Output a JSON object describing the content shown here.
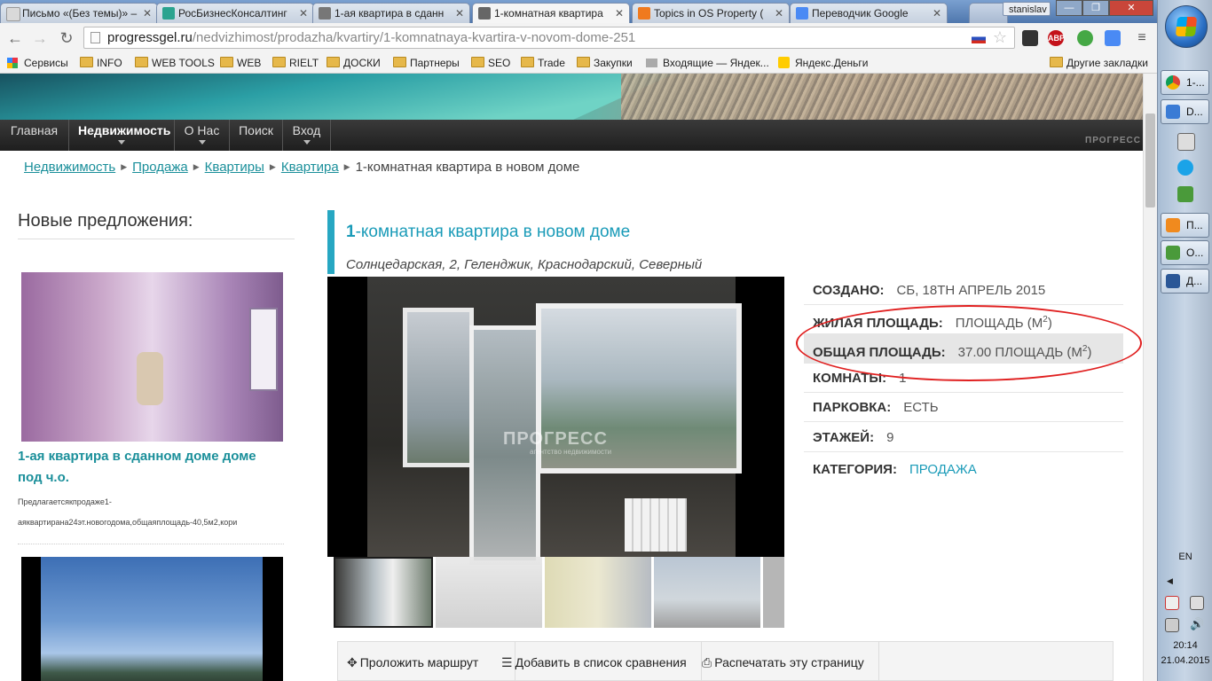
{
  "browser": {
    "tabs": [
      {
        "label": "Письмо «(Без темы)» –"
      },
      {
        "label": "РосБизнесКонсалтинг"
      },
      {
        "label": "1-ая квартира в сданн"
      },
      {
        "label": "1-комнатная квартира"
      },
      {
        "label": "Topics in OS Property ("
      },
      {
        "label": "Переводчик Google"
      }
    ],
    "user_badge": "stanislav",
    "url_host": "progressgel.ru",
    "url_path": "/nedvizhimost/prodazha/kvartiry/1-komnatnaya-kvartira-v-novom-dome-251",
    "abp_label": "ABP",
    "bookmarks": [
      "Сервисы",
      "INFO",
      "WEB TOOLS",
      "WEB",
      "RIELT",
      "ДОСКИ",
      "Партнеры",
      "SEO",
      "Trade",
      "Закупки",
      "Входящие — Яндек...",
      "Яндекс.Деньги"
    ],
    "other_bookmarks": "Другие закладки"
  },
  "site": {
    "menu": [
      "Главная",
      "Недвижимость",
      "О Нас",
      "Поиск",
      "Вход"
    ],
    "logo_text": "ПРОГРЕСС",
    "breadcrumb": [
      "Недвижимость",
      "Продажа",
      "Квартиры",
      "Квартира",
      "1-комнатная квартира в новом доме"
    ]
  },
  "sidebar": {
    "title": "Новые предложения:",
    "offer1_title": "1-ая квартира в сданном доме доме под ч.о.",
    "offer1_desc": "Предлагаетсякпродаже1-аяквартирана24эт.новогодома,общаяплощадь-40,5м2,кори"
  },
  "listing": {
    "title_first": "1",
    "title_rest": "-комнатная квартира в новом доме",
    "address": "Солнцедарская, 2, Геленджик, Краснодарский, Северный",
    "watermark": "ПРОГРЕСС",
    "watermark_sub": "агентство недвижимости",
    "details": [
      {
        "key": "СОЗДАНО:",
        "value": "СБ, 18TH АПРЕЛЬ 2015"
      },
      {
        "key": "ЖИЛАЯ ПЛОЩАДЬ:",
        "value": "ПЛОЩАДЬ (М",
        "sup": "2",
        "tail": ")"
      },
      {
        "key": "ОБЩАЯ ПЛОЩАДЬ:",
        "value": "37.00 ПЛОЩАДЬ (М",
        "sup": "2",
        "tail": ")"
      },
      {
        "key": "КОМНАТЫ:",
        "value": "1"
      },
      {
        "key": "ПАРКОВКА:",
        "value": "ЕСТЬ"
      },
      {
        "key": "ЭТАЖЕЙ:",
        "value": "9"
      },
      {
        "key": "КАТЕГОРИЯ:",
        "value": "ПРОДАЖА"
      }
    ],
    "actions": [
      "Проложить маршрут",
      "Добавить в список сравнения",
      "Распечатать эту страницу"
    ],
    "annotation_color": "#e02020",
    "accent_color": "#1a9bb8"
  },
  "taskbar": {
    "buttons": [
      "1-...",
      "D...",
      "П...",
      "O...",
      "Д..."
    ],
    "language": "EN",
    "time": "20:14",
    "date": "21.04.2015"
  }
}
